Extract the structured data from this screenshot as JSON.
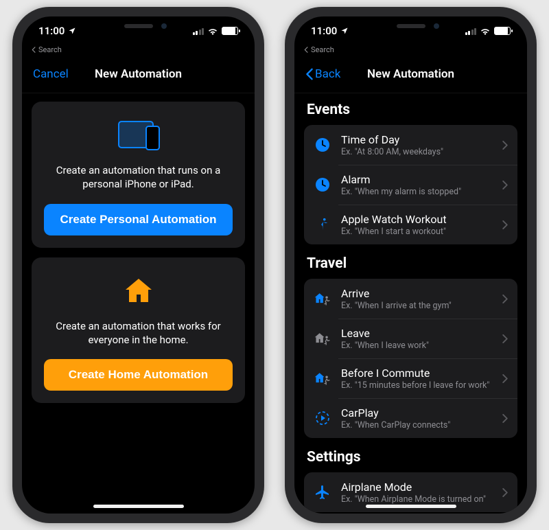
{
  "status": {
    "time": "11:00",
    "breadcrumb_back": "Search"
  },
  "left": {
    "nav": {
      "cancel": "Cancel",
      "title": "New Automation"
    },
    "personal": {
      "description": "Create an automation that runs on a personal iPhone or iPad.",
      "button": "Create Personal Automation"
    },
    "home": {
      "description": "Create an automation that works for everyone in the home.",
      "button": "Create Home Automation"
    }
  },
  "right": {
    "nav": {
      "back": "Back",
      "title": "New Automation"
    },
    "sections": {
      "events": {
        "header": "Events",
        "items": [
          {
            "title": "Time of Day",
            "subtitle": "Ex. \"At 8:00 AM, weekdays\"",
            "icon": "clock"
          },
          {
            "title": "Alarm",
            "subtitle": "Ex. \"When my alarm is stopped\"",
            "icon": "clock"
          },
          {
            "title": "Apple Watch Workout",
            "subtitle": "Ex. \"When I start a workout\"",
            "icon": "runner"
          }
        ]
      },
      "travel": {
        "header": "Travel",
        "items": [
          {
            "title": "Arrive",
            "subtitle": "Ex. \"When I arrive at the gym\"",
            "icon": "house-arrive"
          },
          {
            "title": "Leave",
            "subtitle": "Ex. \"When I leave work\"",
            "icon": "house-leave"
          },
          {
            "title": "Before I Commute",
            "subtitle": "Ex. \"15 minutes before I leave for work\"",
            "icon": "house-arrive"
          },
          {
            "title": "CarPlay",
            "subtitle": "Ex. \"When CarPlay connects\"",
            "icon": "carplay"
          }
        ]
      },
      "settings": {
        "header": "Settings",
        "items": [
          {
            "title": "Airplane Mode",
            "subtitle": "Ex. \"When Airplane Mode is turned on\"",
            "icon": "airplane"
          }
        ]
      }
    }
  },
  "colors": {
    "blue": "#0a84ff",
    "orange": "#ff9f0a"
  }
}
